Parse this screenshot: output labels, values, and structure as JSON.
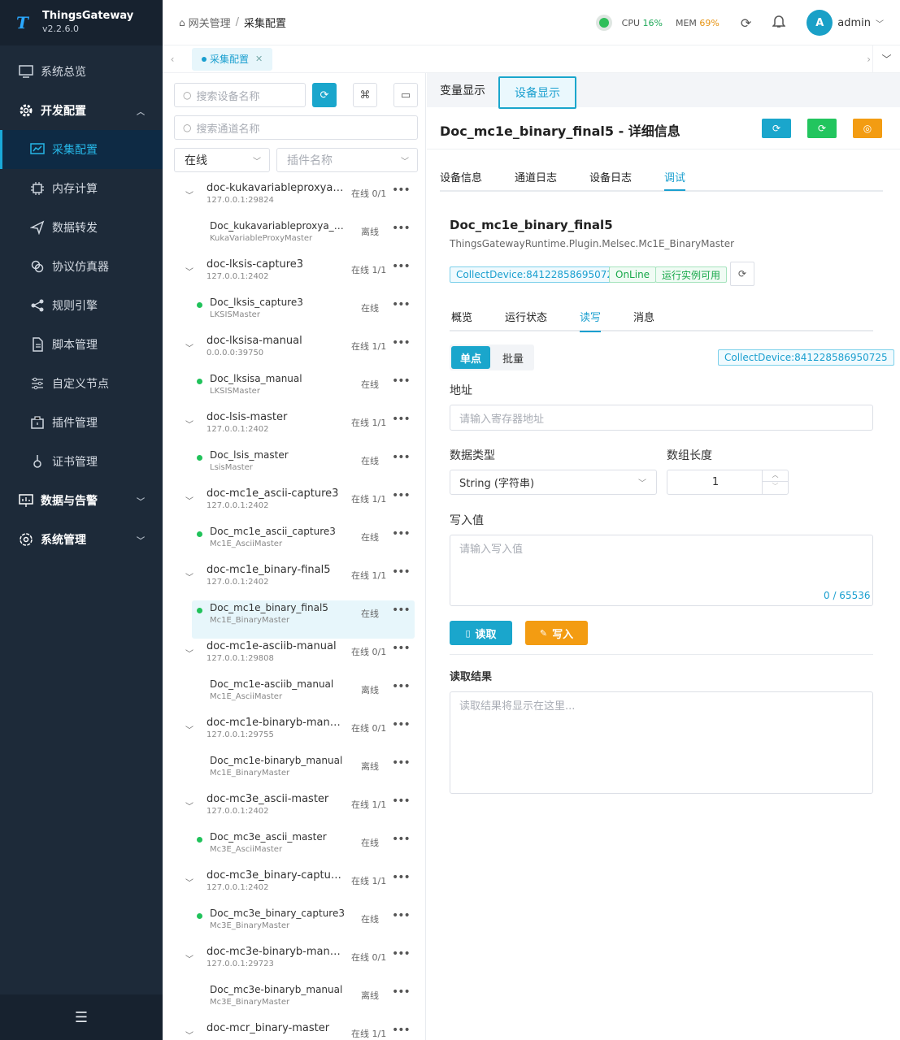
{
  "app": {
    "name": "ThingsGateway",
    "version": "v2.2.6.0"
  },
  "sidebar": {
    "items": [
      {
        "label": "系统总览"
      },
      {
        "label": "开发配置"
      },
      {
        "label": "采集配置"
      },
      {
        "label": "内存计算"
      },
      {
        "label": "数据转发"
      },
      {
        "label": "协议仿真器"
      },
      {
        "label": "规则引擎"
      },
      {
        "label": "脚本管理"
      },
      {
        "label": "自定义节点"
      },
      {
        "label": "插件管理"
      },
      {
        "label": "证书管理"
      },
      {
        "label": "数据与告警"
      },
      {
        "label": "系统管理"
      }
    ]
  },
  "header": {
    "breadcrumb_root": "网关管理",
    "breadcrumb_current": "采集配置",
    "cpu_label": "CPU",
    "cpu_value": "16%",
    "mem_label": "MEM",
    "mem_value": "69%",
    "avatar_letter": "A",
    "username": "admin"
  },
  "page_tab": {
    "label": "采集配置"
  },
  "tree": {
    "search_device_placeholder": "搜索设备名称",
    "search_channel_placeholder": "搜索通道名称",
    "status_filter": "在线",
    "plugin_filter_placeholder": "插件名称",
    "nodes": [
      {
        "name": "doc-kukavariableproxya-m...",
        "addr": "127.0.0.1:29824",
        "status": "在线 0/1"
      },
      {
        "name": "Doc_kukavariableproxya_ma...",
        "addr": "KukaVariableProxyMaster",
        "status": "离线",
        "child": true,
        "online": false
      },
      {
        "name": "doc-lksis-capture3",
        "addr": "127.0.0.1:2402",
        "status": "在线 1/1"
      },
      {
        "name": "Doc_lksis_capture3",
        "addr": "LKSISMaster",
        "status": "在线",
        "child": true,
        "online": true
      },
      {
        "name": "doc-lksisa-manual",
        "addr": "0.0.0.0:39750",
        "status": "在线 1/1"
      },
      {
        "name": "Doc_lksisa_manual",
        "addr": "LKSISMaster",
        "status": "在线",
        "child": true,
        "online": true
      },
      {
        "name": "doc-lsis-master",
        "addr": "127.0.0.1:2402",
        "status": "在线 1/1"
      },
      {
        "name": "Doc_lsis_master",
        "addr": "LsisMaster",
        "status": "在线",
        "child": true,
        "online": true
      },
      {
        "name": "doc-mc1e_ascii-capture3",
        "addr": "127.0.0.1:2402",
        "status": "在线 1/1"
      },
      {
        "name": "Doc_mc1e_ascii_capture3",
        "addr": "Mc1E_AsciiMaster",
        "status": "在线",
        "child": true,
        "online": true
      },
      {
        "name": "doc-mc1e_binary-final5",
        "addr": "127.0.0.1:2402",
        "status": "在线 1/1"
      },
      {
        "name": "Doc_mc1e_binary_final5",
        "addr": "Mc1E_BinaryMaster",
        "status": "在线",
        "child": true,
        "online": true,
        "selected": true
      },
      {
        "name": "doc-mc1e-asciib-manual",
        "addr": "127.0.0.1:29808",
        "status": "在线 0/1"
      },
      {
        "name": "Doc_mc1e-asciib_manual",
        "addr": "Mc1E_AsciiMaster",
        "status": "离线",
        "child": true,
        "online": false
      },
      {
        "name": "doc-mc1e-binaryb-manual",
        "addr": "127.0.0.1:29755",
        "status": "在线 0/1"
      },
      {
        "name": "Doc_mc1e-binaryb_manual",
        "addr": "Mc1E_BinaryMaster",
        "status": "离线",
        "child": true,
        "online": false
      },
      {
        "name": "doc-mc3e_ascii-master",
        "addr": "127.0.0.1:2402",
        "status": "在线 1/1"
      },
      {
        "name": "Doc_mc3e_ascii_master",
        "addr": "Mc3E_AsciiMaster",
        "status": "在线",
        "child": true,
        "online": true
      },
      {
        "name": "doc-mc3e_binary-capture3",
        "addr": "127.0.0.1:2402",
        "status": "在线 1/1"
      },
      {
        "name": "Doc_mc3e_binary_capture3",
        "addr": "Mc3E_BinaryMaster",
        "status": "在线",
        "child": true,
        "online": true
      },
      {
        "name": "doc-mc3e-binaryb-manual",
        "addr": "127.0.0.1:29723",
        "status": "在线 0/1"
      },
      {
        "name": "Doc_mc3e-binaryb_manual",
        "addr": "Mc3E_BinaryMaster",
        "status": "离线",
        "child": true,
        "online": false
      },
      {
        "name": "doc-mcr_binary-master",
        "addr": "",
        "status": "在线 1/1"
      }
    ]
  },
  "right": {
    "tab_vars": "变量显示",
    "tab_devs": "设备显示",
    "title": "Doc_mc1e_binary_final5 - 详细信息",
    "subtabs": [
      "设备信息",
      "通道日志",
      "设备日志",
      "调试"
    ],
    "device_name": "Doc_mc1e_binary_final5",
    "device_plugin": "ThingsGatewayRuntime.Plugin.Melsec.Mc1E_BinaryMaster",
    "tag_collect": "CollectDevice:841228586950725",
    "tag_online": "OnLine",
    "tag_instance": "运行实例可用",
    "inner_tabs": [
      "概览",
      "运行状态",
      "读写",
      "消息"
    ],
    "mode_single": "单点",
    "mode_batch": "批量",
    "collect_tag_right": "CollectDevice:841228586950725",
    "address_label": "地址",
    "address_placeholder": "请输入寄存器地址",
    "datatype_label": "数据类型",
    "datatype_value": "String (字符串)",
    "arraylen_label": "数组长度",
    "arraylen_value": "1",
    "write_label": "写入值",
    "write_placeholder": "请输入写入值",
    "counter": "0 / 65536",
    "read_btn": "读取",
    "write_btn": "写入",
    "result_label": "读取结果",
    "result_placeholder": "读取结果将显示在这里..."
  },
  "colors": {
    "accent": "#1aa6cc",
    "green": "#22c55e",
    "orange": "#f39c12",
    "sidebar": "#1d2a39"
  }
}
